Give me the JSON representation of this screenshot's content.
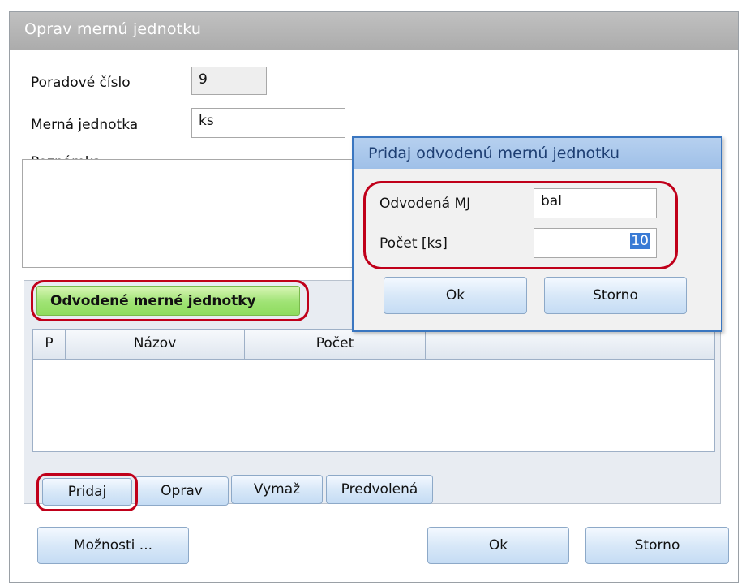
{
  "window": {
    "title": "Oprav mernú jednotku",
    "fields": {
      "poradove_cislo_label": "Poradové číslo",
      "poradove_cislo_value": "9",
      "merna_jednotka_label": "Merná jednotka",
      "merna_jednotka_value": "ks",
      "poznamka_label": "Poznámka",
      "poznamka_value": ""
    },
    "group": {
      "title": "Odvodené merné jednotky",
      "columns": [
        "P",
        "Názov",
        "Počet"
      ],
      "rows": [],
      "buttons": {
        "add": "Pridaj",
        "edit": "Oprav",
        "delete": "Vymaž",
        "default": "Predvolená"
      }
    },
    "footer": {
      "options": "Možnosti ...",
      "ok": "Ok",
      "cancel": "Storno"
    }
  },
  "dialog": {
    "title": "Pridaj odvodenú mernú jednotku",
    "odvodena_label": "Odvodená MJ",
    "odvodena_value": "bal",
    "pocet_label": "Počet [ks]",
    "pocet_value": "10",
    "ok": "Ok",
    "cancel": "Storno"
  },
  "colors": {
    "highlight_ring": "#c0001a",
    "group_tab_green": "#9fe374",
    "dialog_border": "#3a76c0",
    "selection": "#3a7bd5"
  }
}
